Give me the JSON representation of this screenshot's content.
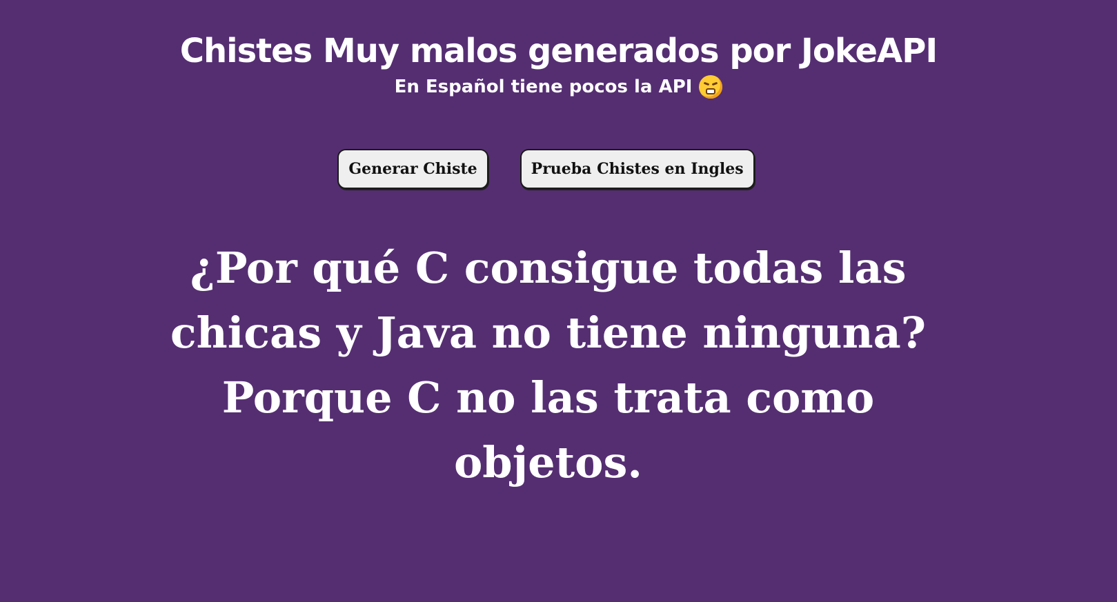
{
  "header": {
    "title": "Chistes Muy malos generados por JokeAPI",
    "subtitle": "En Español tiene pocos la API",
    "subtitle_emoji": "face-with-steam-from-nose-emoji"
  },
  "buttons": {
    "generate_label": "Generar Chiste",
    "english_label": "Prueba Chistes en Ingles"
  },
  "joke": {
    "text": "¿Por qué C consigue todas las chicas y Java no tiene ninguna? Porque C no las trata como objetos."
  },
  "colors": {
    "background": "#552e72",
    "text": "#ffffff",
    "button_bg": "#efefef",
    "button_text": "#111111"
  }
}
